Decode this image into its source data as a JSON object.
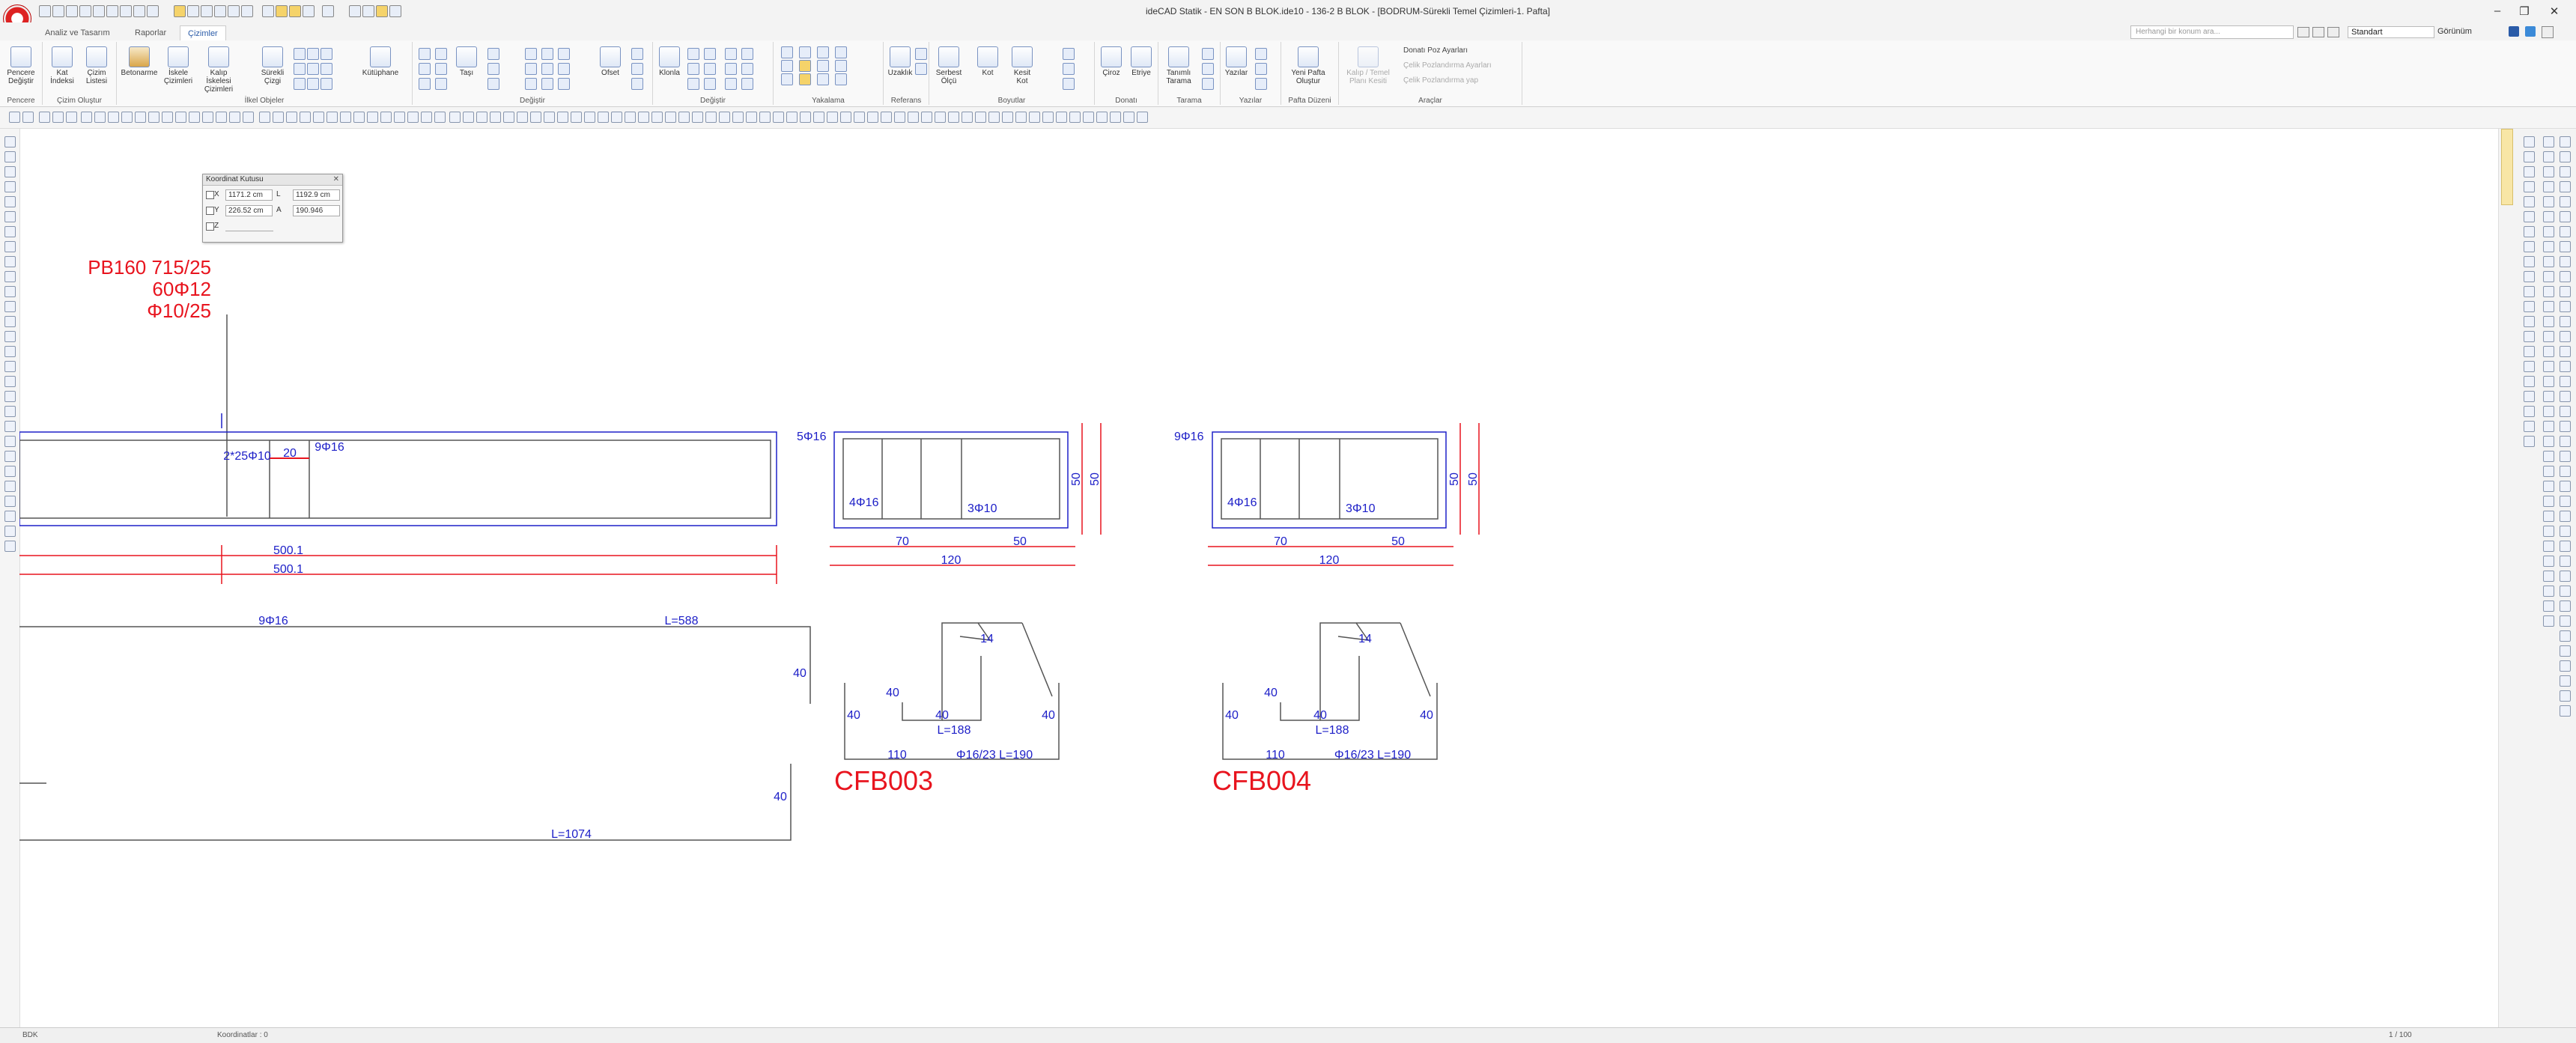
{
  "window": {
    "title": "ideCAD Statik - EN SON B BLOK.ide10 - 136-2 B BLOK - [BODRUM-Sürekli Temel Çizimleri-1. Pafta]",
    "controls": [
      "–",
      "❐",
      "✕"
    ]
  },
  "tabs": [
    {
      "label": "Analiz ve Tasarım",
      "active": false
    },
    {
      "label": "Raporlar",
      "active": false
    },
    {
      "label": "Çizimler",
      "active": true
    }
  ],
  "search": {
    "placeholder": "Herhangi bir konum ara..."
  },
  "style_select": {
    "value": "Standart"
  },
  "view_menu": {
    "label": "Görünüm"
  },
  "ribbon": {
    "groups": [
      {
        "label": "Pencere",
        "buttons": [
          "Pencere Değiştir"
        ]
      },
      {
        "label": "Çizim Oluştur",
        "buttons": [
          "Kat İndeksi",
          "Çizim Listesi"
        ]
      },
      {
        "label": "İlkel Objeler",
        "buttons": [
          "Betonarme",
          "İskele Çizimleri",
          "Kalıp İskelesi Çizimleri",
          "Sürekli Çizgi",
          "Kütüphane"
        ]
      },
      {
        "label": "Değiştir",
        "buttons": [
          "Taşı",
          "Ofset"
        ]
      },
      {
        "label": "Değiştir",
        "buttons": [
          "Klonla"
        ]
      },
      {
        "label": "Yakalama",
        "buttons": []
      },
      {
        "label": "Referans",
        "buttons": [
          "Uzaklık"
        ]
      },
      {
        "label": "Boyutlar",
        "buttons": [
          "Serbest Ölçü",
          "Kot",
          "Kesit Kot"
        ]
      },
      {
        "label": "Donatı",
        "buttons": [
          "Çiroz",
          "Etriye"
        ]
      },
      {
        "label": "Tarama",
        "buttons": [
          "Tanımlı Tarama"
        ]
      },
      {
        "label": "Yazılar",
        "buttons": [
          "Yazılar"
        ]
      },
      {
        "label": "Pafta Düzeni",
        "buttons": [
          "Yeni Pafta Oluştur"
        ]
      },
      {
        "label": "Araçlar",
        "buttons": [
          "Kalıp / Temel Planı Kesiti"
        ]
      }
    ],
    "tools": {
      "donati_poz": "Donatı Poz Ayarları",
      "celik_ayar": "Çelik Pozlandırma Ayarları",
      "celik_yap": "Çelik Pozlandırma yap"
    }
  },
  "coord_box": {
    "title": "Koordinat Kutusu",
    "x_label": "X",
    "x_value": "1171.2 cm",
    "y_label": "Y",
    "y_value": "226.52 cm",
    "z_label": "Z",
    "l_label": "L",
    "l_value": "1192.9 cm",
    "a_label": "A",
    "a_value": "190.946"
  },
  "drawing": {
    "beam_note": [
      "PB160 715/25",
      "60Φ12",
      "Φ10/25"
    ],
    "main_section": {
      "stirrup_label": "2*25Φ10",
      "dim_20": "20",
      "top_bar": "9Φ16",
      "dim_500a": "500.1",
      "dim_500b": "500.1"
    },
    "section1": {
      "top_label": "5Φ16",
      "bottom_left": "4Φ16",
      "bottom_right": "3Φ10",
      "h1": "50",
      "h2": "50",
      "w1": "70",
      "w2": "50",
      "wt": "120"
    },
    "section2": {
      "top_label": "9Φ16",
      "bottom_left": "4Φ16",
      "bottom_right": "3Φ10",
      "h1": "50",
      "h2": "50",
      "w1": "70",
      "w2": "50",
      "wt": "120"
    },
    "long_bar": {
      "label_9f16": "9Φ16",
      "length_top": "L=588",
      "dim40a": "40",
      "dim40b": "40",
      "length_bottom": "L=1074"
    },
    "stirrup1": {
      "d14": "14",
      "d40a": "40",
      "d40b": "40",
      "d40c": "40",
      "d40d": "40",
      "len": "L=188",
      "d110": "110",
      "spec": "Φ16/23  L=190",
      "name": "CFB003"
    },
    "stirrup2": {
      "d14": "14",
      "d40a": "40",
      "d40b": "40",
      "d40c": "40",
      "d40d": "40",
      "len": "L=188",
      "d110": "110",
      "spec": "Φ16/23  L=190",
      "name": "CFB004"
    }
  },
  "colors": {
    "red": "#e8141e",
    "blue": "#1e20c8",
    "accent": "#2a5ba8"
  },
  "status": {
    "left": "BDK",
    "middle": "Koordinatlar : 0",
    "scale": "1 / 100"
  }
}
